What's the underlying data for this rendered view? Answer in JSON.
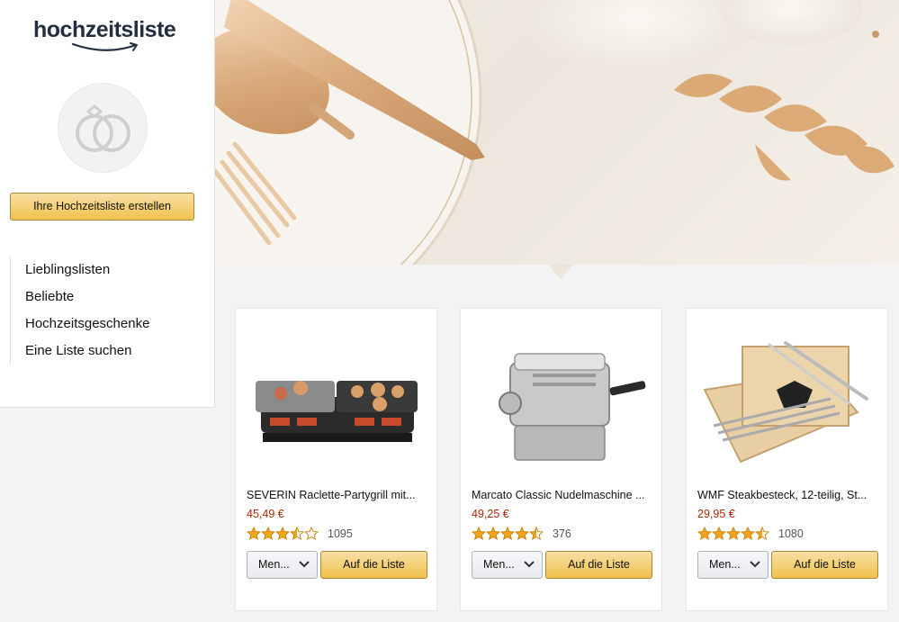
{
  "brand": {
    "logo_text": "hochzeitsliste",
    "accent": "#f0c14b",
    "logo_color": "#232f3e",
    "smile_color": "#232f3e"
  },
  "sidebar": {
    "icon": "wedding-rings-icon",
    "create_button": "Ihre Hochzeitsliste erstellen",
    "nav": [
      {
        "label": "Lieblingslisten"
      },
      {
        "label": "Beliebte"
      },
      {
        "label": "Hochzeitsgeschenke"
      },
      {
        "label": "Eine Liste suchen"
      }
    ]
  },
  "hero": {
    "image": "gold-cutlery-plate-photo"
  },
  "products": [
    {
      "title": "SEVERIN Raclette-Partygrill mit...",
      "price": "45,49 €",
      "rating": 3.5,
      "reviews": "1095",
      "select_label": "Men...",
      "add_label": "Auf die Liste",
      "image": "raclette-grill-image"
    },
    {
      "title": "Marcato Classic Nudelmaschine ...",
      "price": "49,25 €",
      "rating": 4.5,
      "reviews": "376",
      "select_label": "Men...",
      "add_label": "Auf die Liste",
      "image": "pasta-machine-image"
    },
    {
      "title": "WMF Steakbesteck, 12-teilig, St...",
      "price": "29,95 €",
      "rating": 4.5,
      "reviews": "1080",
      "select_label": "Men...",
      "add_label": "Auf die Liste",
      "image": "steak-cutlery-set-image"
    }
  ],
  "colors": {
    "price": "#b12704",
    "star": "#f4a31c"
  }
}
